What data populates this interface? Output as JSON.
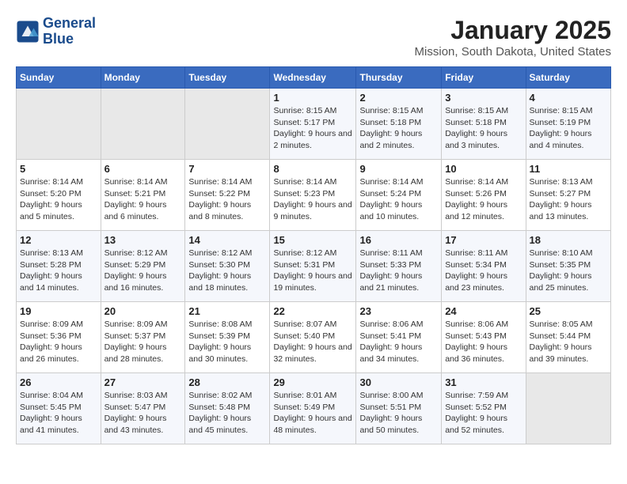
{
  "header": {
    "logo_line1": "General",
    "logo_line2": "Blue",
    "title": "January 2025",
    "subtitle": "Mission, South Dakota, United States"
  },
  "days_of_week": [
    "Sunday",
    "Monday",
    "Tuesday",
    "Wednesday",
    "Thursday",
    "Friday",
    "Saturday"
  ],
  "weeks": [
    [
      {
        "num": "",
        "sunrise": "",
        "sunset": "",
        "daylight": ""
      },
      {
        "num": "",
        "sunrise": "",
        "sunset": "",
        "daylight": ""
      },
      {
        "num": "",
        "sunrise": "",
        "sunset": "",
        "daylight": ""
      },
      {
        "num": "1",
        "sunrise": "Sunrise: 8:15 AM",
        "sunset": "Sunset: 5:17 PM",
        "daylight": "Daylight: 9 hours and 2 minutes."
      },
      {
        "num": "2",
        "sunrise": "Sunrise: 8:15 AM",
        "sunset": "Sunset: 5:18 PM",
        "daylight": "Daylight: 9 hours and 2 minutes."
      },
      {
        "num": "3",
        "sunrise": "Sunrise: 8:15 AM",
        "sunset": "Sunset: 5:18 PM",
        "daylight": "Daylight: 9 hours and 3 minutes."
      },
      {
        "num": "4",
        "sunrise": "Sunrise: 8:15 AM",
        "sunset": "Sunset: 5:19 PM",
        "daylight": "Daylight: 9 hours and 4 minutes."
      }
    ],
    [
      {
        "num": "5",
        "sunrise": "Sunrise: 8:14 AM",
        "sunset": "Sunset: 5:20 PM",
        "daylight": "Daylight: 9 hours and 5 minutes."
      },
      {
        "num": "6",
        "sunrise": "Sunrise: 8:14 AM",
        "sunset": "Sunset: 5:21 PM",
        "daylight": "Daylight: 9 hours and 6 minutes."
      },
      {
        "num": "7",
        "sunrise": "Sunrise: 8:14 AM",
        "sunset": "Sunset: 5:22 PM",
        "daylight": "Daylight: 9 hours and 8 minutes."
      },
      {
        "num": "8",
        "sunrise": "Sunrise: 8:14 AM",
        "sunset": "Sunset: 5:23 PM",
        "daylight": "Daylight: 9 hours and 9 minutes."
      },
      {
        "num": "9",
        "sunrise": "Sunrise: 8:14 AM",
        "sunset": "Sunset: 5:24 PM",
        "daylight": "Daylight: 9 hours and 10 minutes."
      },
      {
        "num": "10",
        "sunrise": "Sunrise: 8:14 AM",
        "sunset": "Sunset: 5:26 PM",
        "daylight": "Daylight: 9 hours and 12 minutes."
      },
      {
        "num": "11",
        "sunrise": "Sunrise: 8:13 AM",
        "sunset": "Sunset: 5:27 PM",
        "daylight": "Daylight: 9 hours and 13 minutes."
      }
    ],
    [
      {
        "num": "12",
        "sunrise": "Sunrise: 8:13 AM",
        "sunset": "Sunset: 5:28 PM",
        "daylight": "Daylight: 9 hours and 14 minutes."
      },
      {
        "num": "13",
        "sunrise": "Sunrise: 8:12 AM",
        "sunset": "Sunset: 5:29 PM",
        "daylight": "Daylight: 9 hours and 16 minutes."
      },
      {
        "num": "14",
        "sunrise": "Sunrise: 8:12 AM",
        "sunset": "Sunset: 5:30 PM",
        "daylight": "Daylight: 9 hours and 18 minutes."
      },
      {
        "num": "15",
        "sunrise": "Sunrise: 8:12 AM",
        "sunset": "Sunset: 5:31 PM",
        "daylight": "Daylight: 9 hours and 19 minutes."
      },
      {
        "num": "16",
        "sunrise": "Sunrise: 8:11 AM",
        "sunset": "Sunset: 5:33 PM",
        "daylight": "Daylight: 9 hours and 21 minutes."
      },
      {
        "num": "17",
        "sunrise": "Sunrise: 8:11 AM",
        "sunset": "Sunset: 5:34 PM",
        "daylight": "Daylight: 9 hours and 23 minutes."
      },
      {
        "num": "18",
        "sunrise": "Sunrise: 8:10 AM",
        "sunset": "Sunset: 5:35 PM",
        "daylight": "Daylight: 9 hours and 25 minutes."
      }
    ],
    [
      {
        "num": "19",
        "sunrise": "Sunrise: 8:09 AM",
        "sunset": "Sunset: 5:36 PM",
        "daylight": "Daylight: 9 hours and 26 minutes."
      },
      {
        "num": "20",
        "sunrise": "Sunrise: 8:09 AM",
        "sunset": "Sunset: 5:37 PM",
        "daylight": "Daylight: 9 hours and 28 minutes."
      },
      {
        "num": "21",
        "sunrise": "Sunrise: 8:08 AM",
        "sunset": "Sunset: 5:39 PM",
        "daylight": "Daylight: 9 hours and 30 minutes."
      },
      {
        "num": "22",
        "sunrise": "Sunrise: 8:07 AM",
        "sunset": "Sunset: 5:40 PM",
        "daylight": "Daylight: 9 hours and 32 minutes."
      },
      {
        "num": "23",
        "sunrise": "Sunrise: 8:06 AM",
        "sunset": "Sunset: 5:41 PM",
        "daylight": "Daylight: 9 hours and 34 minutes."
      },
      {
        "num": "24",
        "sunrise": "Sunrise: 8:06 AM",
        "sunset": "Sunset: 5:43 PM",
        "daylight": "Daylight: 9 hours and 36 minutes."
      },
      {
        "num": "25",
        "sunrise": "Sunrise: 8:05 AM",
        "sunset": "Sunset: 5:44 PM",
        "daylight": "Daylight: 9 hours and 39 minutes."
      }
    ],
    [
      {
        "num": "26",
        "sunrise": "Sunrise: 8:04 AM",
        "sunset": "Sunset: 5:45 PM",
        "daylight": "Daylight: 9 hours and 41 minutes."
      },
      {
        "num": "27",
        "sunrise": "Sunrise: 8:03 AM",
        "sunset": "Sunset: 5:47 PM",
        "daylight": "Daylight: 9 hours and 43 minutes."
      },
      {
        "num": "28",
        "sunrise": "Sunrise: 8:02 AM",
        "sunset": "Sunset: 5:48 PM",
        "daylight": "Daylight: 9 hours and 45 minutes."
      },
      {
        "num": "29",
        "sunrise": "Sunrise: 8:01 AM",
        "sunset": "Sunset: 5:49 PM",
        "daylight": "Daylight: 9 hours and 48 minutes."
      },
      {
        "num": "30",
        "sunrise": "Sunrise: 8:00 AM",
        "sunset": "Sunset: 5:51 PM",
        "daylight": "Daylight: 9 hours and 50 minutes."
      },
      {
        "num": "31",
        "sunrise": "Sunrise: 7:59 AM",
        "sunset": "Sunset: 5:52 PM",
        "daylight": "Daylight: 9 hours and 52 minutes."
      },
      {
        "num": "",
        "sunrise": "",
        "sunset": "",
        "daylight": ""
      }
    ]
  ]
}
